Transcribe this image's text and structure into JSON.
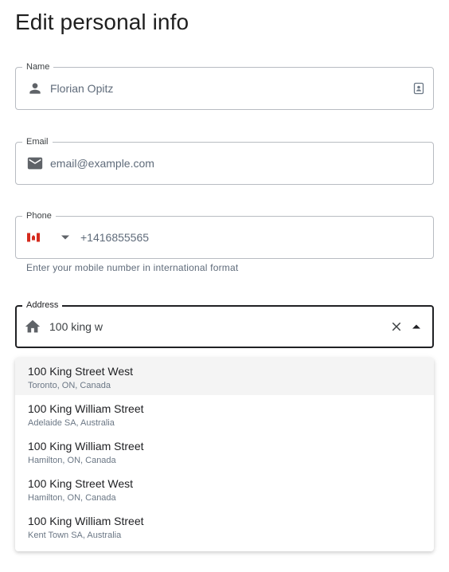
{
  "page": {
    "title": "Edit personal info"
  },
  "name_field": {
    "label": "Name",
    "value": "Florian Opitz"
  },
  "email_field": {
    "label": "Email",
    "placeholder": "email@example.com"
  },
  "phone_field": {
    "label": "Phone",
    "value": "+1416855565",
    "helper": "Enter your mobile number in international format",
    "country": "Canada"
  },
  "address_field": {
    "label": "Address",
    "value": "100 king w"
  },
  "suggestions": [
    {
      "main": "100 King Street West",
      "sub": "Toronto, ON, Canada"
    },
    {
      "main": "100 King William Street",
      "sub": "Adelaide SA, Australia"
    },
    {
      "main": "100 King William Street",
      "sub": "Hamilton, ON, Canada"
    },
    {
      "main": "100 King Street West",
      "sub": "Hamilton, ON, Canada"
    },
    {
      "main": "100 King William Street",
      "sub": "Kent Town SA, Australia"
    }
  ],
  "colors": {
    "icon": "#5f6368",
    "border": "#b8bcc2",
    "focused_border": "#202124",
    "highlight": "#f4f4f4"
  }
}
